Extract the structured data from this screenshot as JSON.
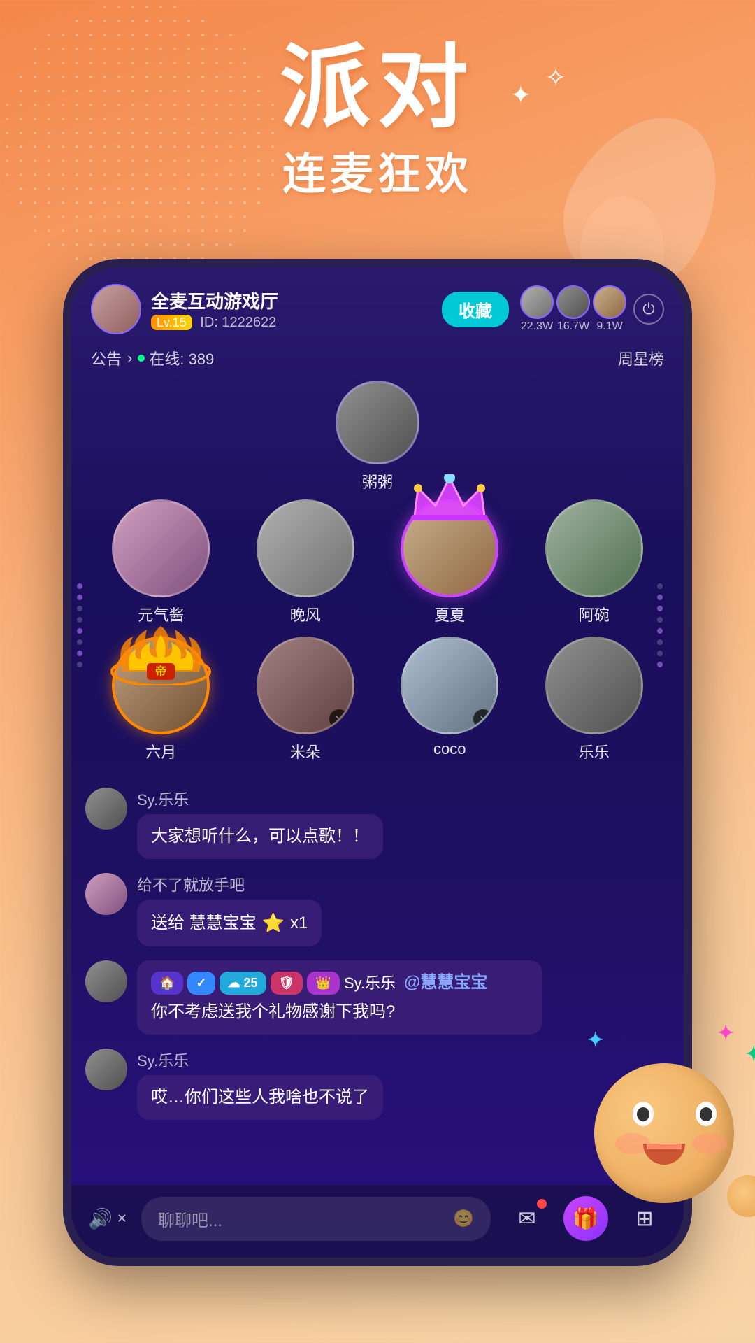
{
  "app": {
    "title_main": "派对",
    "title_sub": "连麦狂欢"
  },
  "header": {
    "host_name": "全麦互动游戏厅",
    "host_level": "Lv.15",
    "host_id": "ID: 1222622",
    "collect_label": "收藏",
    "announce_label": "公告",
    "announce_chevron": ">",
    "online_label": "在线: 389",
    "week_rank_label": "周星榜",
    "power_icon": "⏻",
    "top_users": [
      {
        "count": "22.3W"
      },
      {
        "count": "16.7W"
      },
      {
        "count": "9.1W"
      }
    ]
  },
  "stage": {
    "host_slot_name": "粥粥",
    "performers_row1": [
      {
        "name": "元气酱",
        "type": "normal"
      },
      {
        "name": "晚风",
        "type": "normal"
      },
      {
        "name": "夏夏",
        "type": "crown"
      },
      {
        "name": "阿碗",
        "type": "normal"
      }
    ],
    "performers_row2": [
      {
        "name": "六月",
        "type": "gold"
      },
      {
        "name": "米朵",
        "type": "muted"
      },
      {
        "name": "coco",
        "type": "muted"
      },
      {
        "name": "乐乐",
        "type": "normal"
      }
    ]
  },
  "chat": {
    "messages": [
      {
        "username": "Sy.乐乐",
        "text": "大家想听什么，可以点歌！！",
        "type": "normal"
      },
      {
        "username": "给不了就放手吧",
        "text": "送给 慧慧宝宝",
        "gift": "⭐ x1",
        "type": "gift"
      },
      {
        "username": "Sy.乐乐",
        "badges": [
          "🏠",
          "✓",
          "☁ 25",
          "🛡",
          "👑"
        ],
        "tag": "@慧慧宝宝",
        "text": "你不考虑送我个礼物感谢下我吗?",
        "type": "tagged"
      },
      {
        "username": "Sy.乐乐",
        "text": "哎…你们这些人我啥也不说了",
        "type": "normal"
      }
    ]
  },
  "bottom_bar": {
    "sound_label": "🔊",
    "mute_label": "✕",
    "chat_placeholder": "聊聊吧...",
    "emoji_icon": "😊",
    "mail_icon": "✉",
    "gift_icon": "🎁",
    "grid_icon": "⊞"
  }
}
